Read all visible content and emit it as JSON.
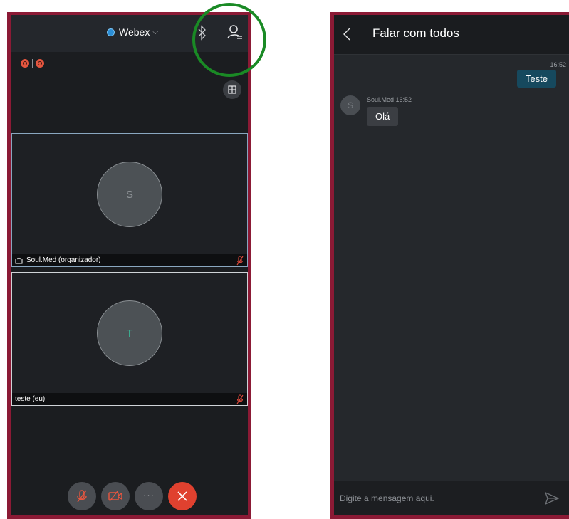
{
  "meeting": {
    "app_name": "Webex",
    "participants": [
      {
        "initial": "S",
        "name": "Soul.Med (organizador)"
      },
      {
        "initial": "T",
        "name": "teste (eu)"
      }
    ]
  },
  "chat": {
    "title": "Falar com todos",
    "sent_message": {
      "time": "16:52",
      "text": "Teste"
    },
    "received_message": {
      "avatar_initial": "S",
      "sender_time": "Soul.Med 16:52",
      "text": "Olá"
    },
    "composer_placeholder": "Digite a mensagem aqui."
  },
  "colors": {
    "frame_border": "#8b1a35",
    "highlight_ring": "#1a8a25",
    "end_call": "#e0412f",
    "sent_bubble": "#16495e"
  },
  "icons": [
    "bluetooth-icon",
    "participants-icon",
    "recording-icon",
    "layout-grid-icon",
    "share-icon",
    "mic-muted-icon",
    "video-off-icon",
    "more-icon",
    "end-call-icon",
    "back-icon",
    "send-icon"
  ]
}
